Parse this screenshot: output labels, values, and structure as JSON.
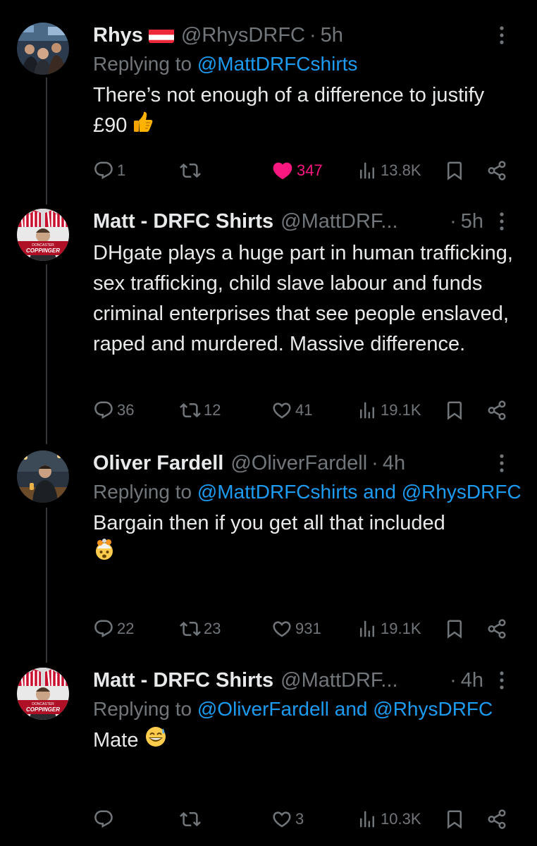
{
  "tweets": [
    {
      "name": "Rhys",
      "handle": "@RhysDRFC",
      "dot": "·",
      "time": "5h",
      "reply_prefix": "Replying to",
      "reply_to": "@MattDRFCshirts",
      "text": "There’s not enough of a difference to justify £90",
      "text_emoji": "thumbs-up",
      "replies": "1",
      "retweets": "",
      "likes": "347",
      "liked": true,
      "views": "13.8K"
    },
    {
      "name": "Matt - DRFC Shirts",
      "handle": "@MattDRF...",
      "dot": "·",
      "time": "5h",
      "text": "DHgate plays a huge part in human trafficking, sex trafficking, child slave labour and funds criminal enterprises that see people enslaved, raped and murdered. Massive difference.",
      "replies": "36",
      "retweets": "12",
      "likes": "41",
      "views": "19.1K"
    },
    {
      "name": "Oliver Fardell",
      "handle": "@OliverFardell",
      "dot": "·",
      "time": "4h",
      "reply_prefix": "Replying to",
      "reply_to": "@MattDRFCshirts and @RhysDRFC",
      "text": "Bargain then if you get all that included",
      "text_emoji": "exploding-head",
      "replies": "22",
      "retweets": "23",
      "likes": "931",
      "views": "19.1K"
    },
    {
      "name": "Matt - DRFC Shirts",
      "handle": "@MattDRF...",
      "dot": "·",
      "time": "4h",
      "reply_prefix": "Replying to",
      "reply_to": "@OliverFardell and @RhysDRFC",
      "text": "Mate",
      "text_emoji": "grinning-sweat",
      "replies": "",
      "retweets": "",
      "likes": "3",
      "views": "10.3K"
    }
  ],
  "avatar_text": "COPPINGER",
  "colors": {
    "bg": "#000000",
    "text": "#e7e9ea",
    "muted": "#71767b",
    "link": "#1d9bf0",
    "like": "#f91880"
  }
}
